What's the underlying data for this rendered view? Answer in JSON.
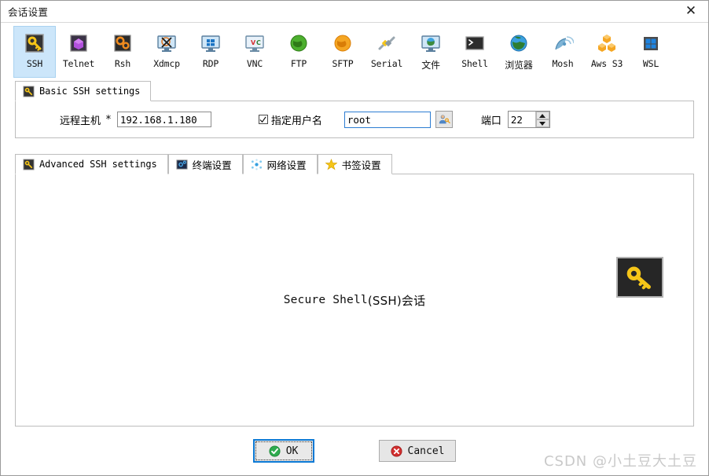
{
  "window": {
    "title": "会话设置",
    "close_label": "✕"
  },
  "protocols": [
    {
      "label": "SSH",
      "icon": "key-icon",
      "selected": true
    },
    {
      "label": "Telnet",
      "icon": "gem-icon",
      "selected": false
    },
    {
      "label": "Rsh",
      "icon": "gears-icon",
      "selected": false
    },
    {
      "label": "Xdmcp",
      "icon": "x-monitor-icon",
      "selected": false
    },
    {
      "label": "RDP",
      "icon": "windows-monitor-icon",
      "selected": false
    },
    {
      "label": "VNC",
      "icon": "vnc-monitor-icon",
      "selected": false
    },
    {
      "label": "FTP",
      "icon": "green-globe-icon",
      "selected": false
    },
    {
      "label": "SFTP",
      "icon": "orange-globe-icon",
      "selected": false
    },
    {
      "label": "Serial",
      "icon": "plug-icon",
      "selected": false
    },
    {
      "label": "文件",
      "icon": "globe-monitor-icon",
      "selected": false
    },
    {
      "label": "Shell",
      "icon": "terminal-icon",
      "selected": false
    },
    {
      "label": "浏览器",
      "icon": "blue-globe-icon",
      "selected": false
    },
    {
      "label": "Mosh",
      "icon": "satellite-icon",
      "selected": false
    },
    {
      "label": "Aws S3",
      "icon": "aws-cubes-icon",
      "selected": false
    },
    {
      "label": "WSL",
      "icon": "windows-icon",
      "selected": false
    }
  ],
  "basic_tab": {
    "label": "Basic SSH settings",
    "icon": "key-icon"
  },
  "basic_form": {
    "host_label": "远程主机",
    "host_required": "*",
    "host_value": "192.168.1.180",
    "specify_user_label": "指定用户名",
    "specify_user_checked": true,
    "username_value": "root",
    "username_placeholder": "",
    "user_button_icon": "user-key-icon",
    "port_label": "端口",
    "port_value": "22"
  },
  "advanced_tabs": [
    {
      "label": "Advanced SSH settings",
      "icon": "key-icon",
      "cjk": false,
      "active": true
    },
    {
      "label": "终端设置",
      "icon": "terminal-settings-icon",
      "cjk": true,
      "active": false
    },
    {
      "label": "网络设置",
      "icon": "network-icon",
      "cjk": true,
      "active": false
    },
    {
      "label": "书签设置",
      "icon": "star-icon",
      "cjk": true,
      "active": false
    }
  ],
  "content": {
    "headline_ascii": "Secure Shell ",
    "headline_cjk": "(SSH)会话",
    "key_icon": "big-key-icon"
  },
  "footer": {
    "ok_label": "OK",
    "ok_icon": "green-check-icon",
    "cancel_label": "Cancel",
    "cancel_icon": "red-x-icon"
  },
  "watermark": "CSDN @小土豆大土豆",
  "colors": {
    "selected_tab_bg": "#cce6fa",
    "focus_border": "#2d7dd2",
    "default_button_border": "#0a78d4",
    "key_yellow": "#f5c518",
    "ok_green": "#2eac4f",
    "cancel_red": "#d32f2f"
  }
}
